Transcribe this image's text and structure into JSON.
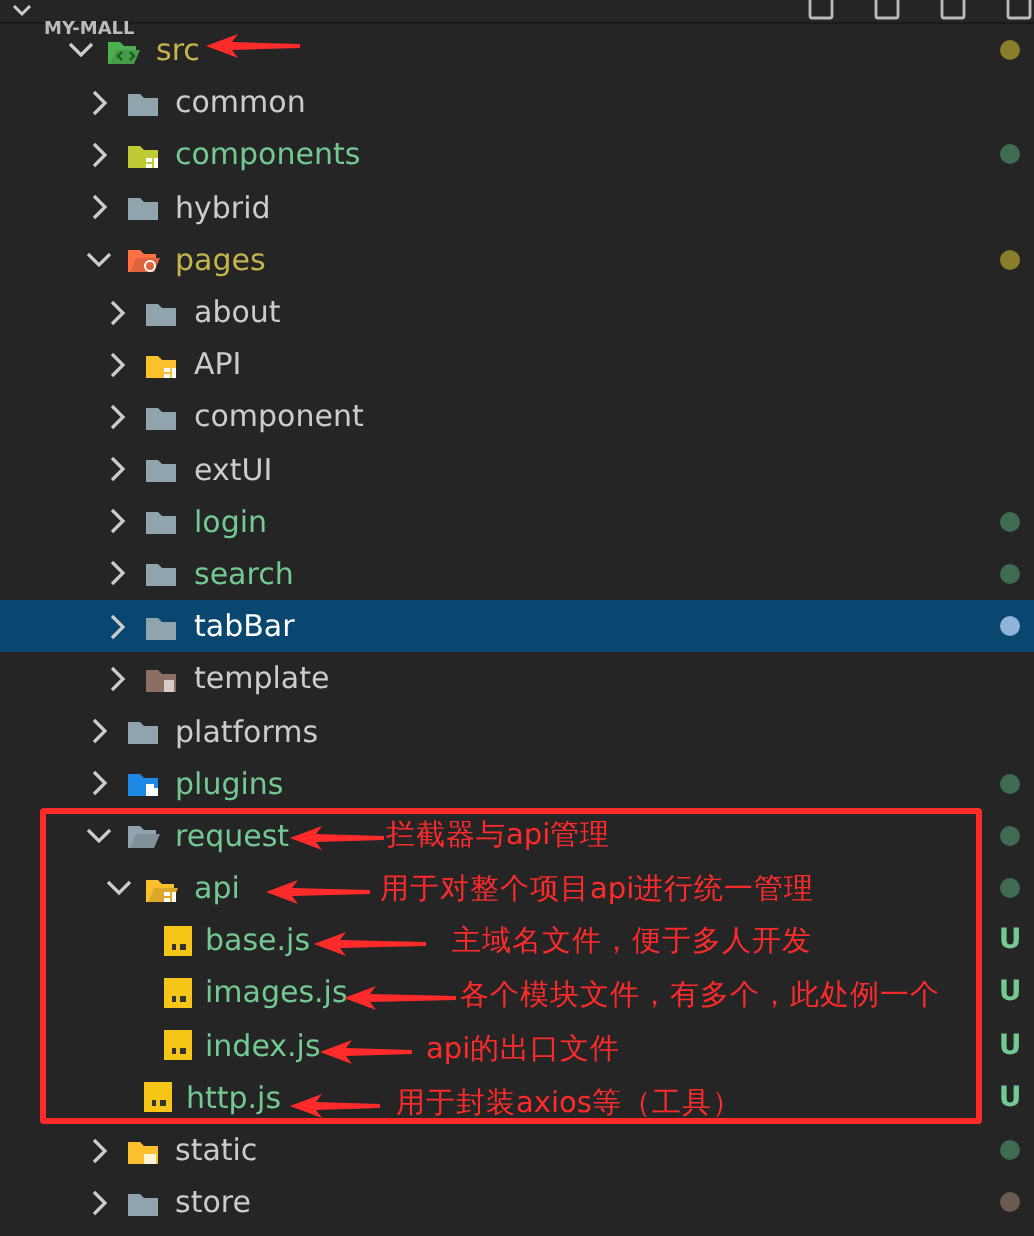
{
  "explorer": {
    "title": "MY-MALL",
    "expanded": true
  },
  "tree": [
    {
      "name": "src",
      "kind": "src",
      "expanded": true,
      "selected": false,
      "color": "#c6b54c",
      "decoration": {
        "color": "#8a7d2c"
      },
      "children": [
        {
          "name": "common",
          "kind": "folder",
          "expanded": false,
          "selected": false,
          "color": "#cccccc"
        },
        {
          "name": "components",
          "kind": "components",
          "expanded": false,
          "selected": false,
          "color": "#73c991",
          "decoration": {
            "color": "#3f6b52"
          }
        },
        {
          "name": "hybrid",
          "kind": "folder",
          "expanded": false,
          "selected": false,
          "color": "#cccccc"
        },
        {
          "name": "pages",
          "kind": "pages",
          "expanded": true,
          "selected": false,
          "color": "#c6b54c",
          "decoration": {
            "color": "#8a7d2c"
          },
          "children": [
            {
              "name": "about",
              "kind": "folder",
              "expanded": false,
              "selected": false,
              "color": "#cccccc"
            },
            {
              "name": "API",
              "kind": "api",
              "expanded": false,
              "selected": false,
              "color": "#cccccc"
            },
            {
              "name": "component",
              "kind": "folder",
              "expanded": false,
              "selected": false,
              "color": "#cccccc"
            },
            {
              "name": "extUI",
              "kind": "folder",
              "expanded": false,
              "selected": false,
              "color": "#cccccc"
            },
            {
              "name": "login",
              "kind": "folder",
              "expanded": false,
              "selected": false,
              "color": "#73c991",
              "decoration": {
                "color": "#3f6b52"
              }
            },
            {
              "name": "search",
              "kind": "folder",
              "expanded": false,
              "selected": false,
              "color": "#73c991",
              "decoration": {
                "color": "#3f6b52"
              }
            },
            {
              "name": "tabBar",
              "kind": "folder",
              "expanded": false,
              "selected": true,
              "color": "#ffffff",
              "decoration": {
                "color": "#8fb3d9"
              }
            },
            {
              "name": "template",
              "kind": "template",
              "expanded": false,
              "selected": false,
              "color": "#cccccc"
            }
          ]
        },
        {
          "name": "platforms",
          "kind": "folder",
          "expanded": false,
          "selected": false,
          "color": "#cccccc"
        },
        {
          "name": "plugins",
          "kind": "plugins",
          "expanded": false,
          "selected": false,
          "color": "#73c991",
          "decoration": {
            "color": "#3f6b52"
          }
        },
        {
          "name": "request",
          "kind": "folder",
          "expanded": true,
          "selected": false,
          "color": "#73c991",
          "decoration": {
            "color": "#3f6b52"
          },
          "children": [
            {
              "name": "api",
              "kind": "api",
              "expanded": true,
              "selected": false,
              "color": "#73c991",
              "decoration": {
                "color": "#3f6b52"
              },
              "children": [
                {
                  "name": "base.js",
                  "kind": "js",
                  "selected": false,
                  "color": "#73c991",
                  "badge": "U"
                },
                {
                  "name": "images.js",
                  "kind": "js",
                  "selected": false,
                  "color": "#73c991",
                  "badge": "U"
                },
                {
                  "name": "index.js",
                  "kind": "js",
                  "selected": false,
                  "color": "#73c991",
                  "badge": "U"
                }
              ]
            },
            {
              "name": "http.js",
              "kind": "js",
              "selected": false,
              "color": "#73c991",
              "badge": "U"
            }
          ]
        },
        {
          "name": "static",
          "kind": "static",
          "expanded": false,
          "selected": false,
          "color": "#cccccc",
          "decoration": {
            "color": "#3f6b52"
          }
        },
        {
          "name": "store",
          "kind": "folder",
          "expanded": false,
          "selected": false,
          "color": "#cccccc",
          "decoration": {
            "color": "#6b5a50"
          }
        }
      ]
    }
  ],
  "annotations": [
    {
      "kind": "arrow"
    },
    {
      "kind": "labeled_arrow",
      "text": "拦截器与api管理"
    },
    {
      "kind": "labeled_arrow",
      "text": "用于对整个项目api进行统一管理"
    },
    {
      "kind": "labeled_arrow",
      "text": "主域名文件，便于多人开发"
    },
    {
      "kind": "labeled_arrow",
      "text": "各个模块文件，有多个，此处例一个"
    },
    {
      "kind": "labeled_arrow",
      "text": "api的出口文件"
    },
    {
      "kind": "labeled_arrow",
      "text": "用于封装axios等（工具）"
    }
  ],
  "highlight_frame": {
    "color": "#ff2b2b"
  }
}
